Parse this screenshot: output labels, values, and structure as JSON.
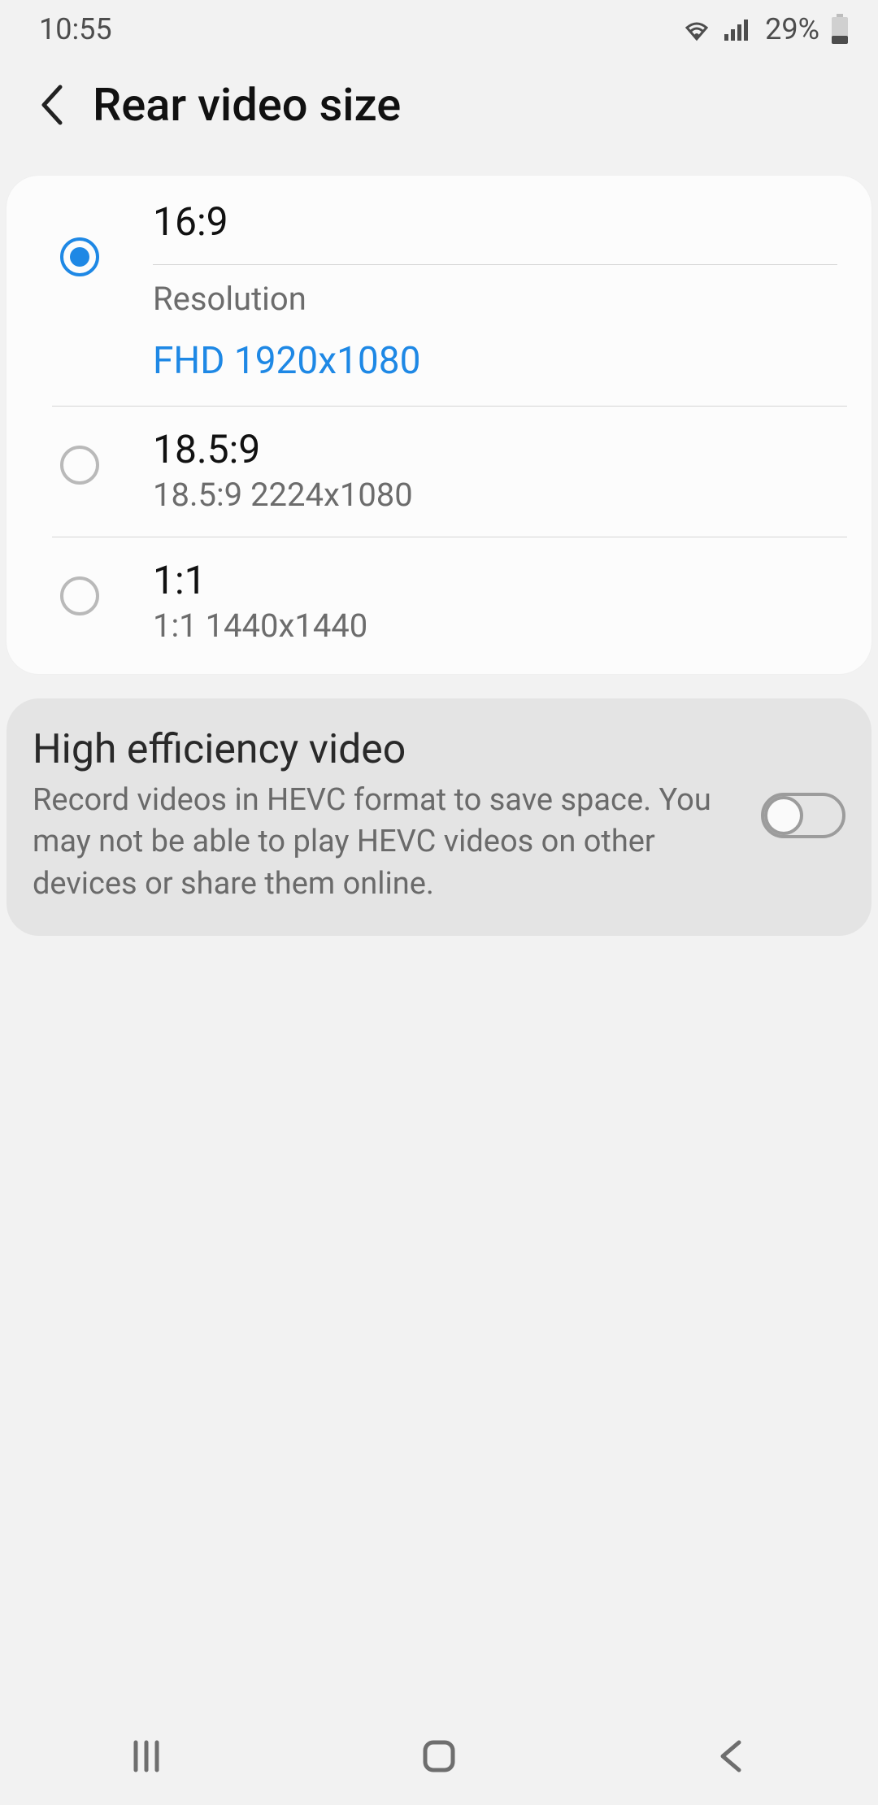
{
  "status": {
    "time": "10:55",
    "battery_pct": "29%"
  },
  "header": {
    "title": "Rear video size"
  },
  "options": [
    {
      "title": "16:9",
      "sub_label": "Resolution",
      "sub_value": "FHD 1920x1080",
      "selected": true
    },
    {
      "title": "18.5:9",
      "sub_value": "18.5:9 2224x1080",
      "selected": false
    },
    {
      "title": "1:1",
      "sub_value": "1:1 1440x1440",
      "selected": false
    }
  ],
  "hevc": {
    "title": "High efficiency video",
    "description": "Record videos in HEVC format to save space. You may not be able to play HEVC videos on other devices or share them online.",
    "enabled": false
  }
}
